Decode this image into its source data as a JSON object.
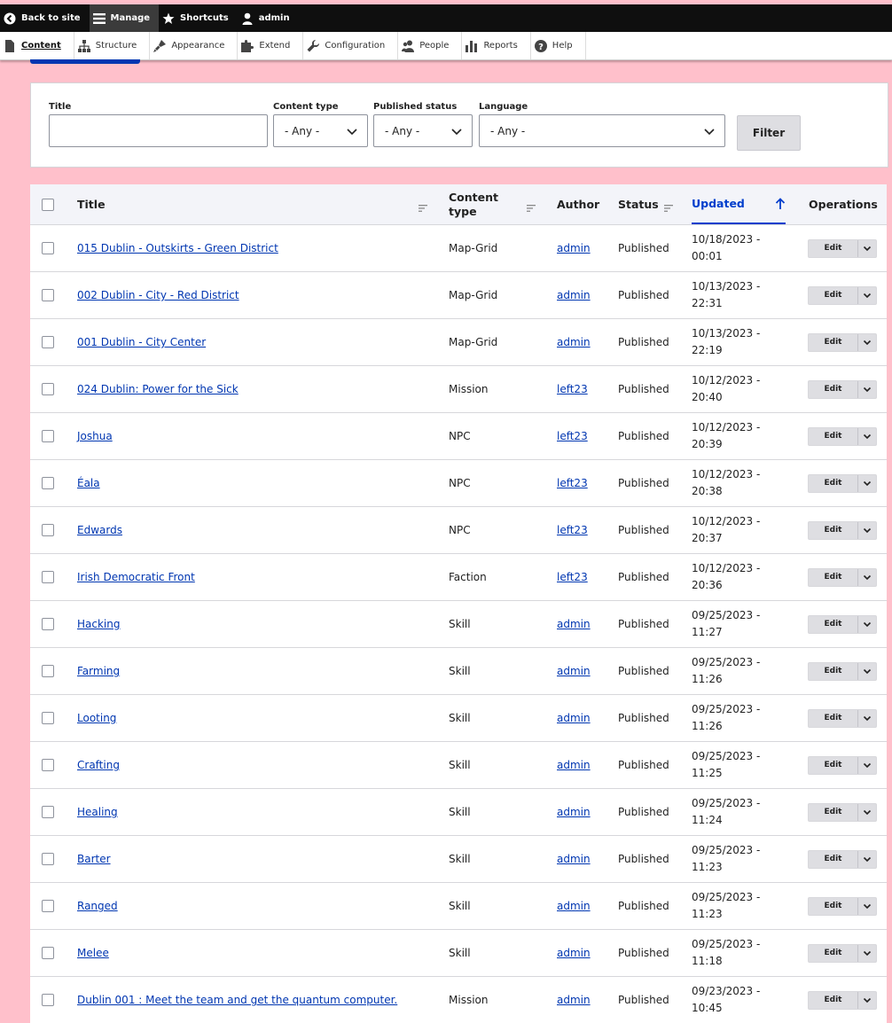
{
  "toolbar": {
    "back": "Back to site",
    "manage": "Manage",
    "shortcuts": "Shortcuts",
    "user": "admin"
  },
  "tray": {
    "items": [
      "Content",
      "Structure",
      "Appearance",
      "Extend",
      "Configuration",
      "People",
      "Reports",
      "Help"
    ]
  },
  "filters": {
    "title_label": "Title",
    "title_value": "",
    "type_label": "Content type",
    "type_value": "- Any -",
    "status_label": "Published status",
    "status_value": "- Any -",
    "lang_label": "Language",
    "lang_value": "- Any -",
    "button": "Filter"
  },
  "table": {
    "headers": {
      "title": "Title",
      "type": "Content type",
      "author": "Author",
      "status": "Status",
      "updated": "Updated",
      "operations": "Operations"
    },
    "edit_label": "Edit",
    "rows": [
      {
        "title": "015 Dublin - Outskirts - Green District",
        "type": "Map-Grid",
        "author": "admin",
        "status": "Published",
        "date": "10/18/2023 -",
        "time": "00:01"
      },
      {
        "title": "002 Dublin - City - Red District",
        "type": "Map-Grid",
        "author": "admin",
        "status": "Published",
        "date": "10/13/2023 -",
        "time": "22:31"
      },
      {
        "title": "001 Dublin - City Center",
        "type": "Map-Grid",
        "author": "admin",
        "status": "Published",
        "date": "10/13/2023 -",
        "time": "22:19"
      },
      {
        "title": "024 Dublin: Power for the Sick",
        "type": "Mission",
        "author": "left23",
        "status": "Published",
        "date": "10/12/2023 -",
        "time": "20:40"
      },
      {
        "title": "Joshua",
        "type": "NPC",
        "author": "left23",
        "status": "Published",
        "date": "10/12/2023 -",
        "time": "20:39"
      },
      {
        "title": "Éala",
        "type": "NPC",
        "author": "left23",
        "status": "Published",
        "date": "10/12/2023 -",
        "time": "20:38"
      },
      {
        "title": "Edwards",
        "type": "NPC",
        "author": "left23",
        "status": "Published",
        "date": "10/12/2023 -",
        "time": "20:37"
      },
      {
        "title": "Irish Democratic Front",
        "type": "Faction",
        "author": "left23",
        "status": "Published",
        "date": "10/12/2023 -",
        "time": "20:36"
      },
      {
        "title": "Hacking",
        "type": "Skill",
        "author": "admin",
        "status": "Published",
        "date": "09/25/2023 -",
        "time": "11:27"
      },
      {
        "title": "Farming",
        "type": "Skill",
        "author": "admin",
        "status": "Published",
        "date": "09/25/2023 -",
        "time": "11:26"
      },
      {
        "title": "Looting",
        "type": "Skill",
        "author": "admin",
        "status": "Published",
        "date": "09/25/2023 -",
        "time": "11:26"
      },
      {
        "title": "Crafting",
        "type": "Skill",
        "author": "admin",
        "status": "Published",
        "date": "09/25/2023 -",
        "time": "11:25"
      },
      {
        "title": "Healing",
        "type": "Skill",
        "author": "admin",
        "status": "Published",
        "date": "09/25/2023 -",
        "time": "11:24"
      },
      {
        "title": "Barter",
        "type": "Skill",
        "author": "admin",
        "status": "Published",
        "date": "09/25/2023 -",
        "time": "11:23"
      },
      {
        "title": "Ranged",
        "type": "Skill",
        "author": "admin",
        "status": "Published",
        "date": "09/25/2023 -",
        "time": "11:23"
      },
      {
        "title": "Melee",
        "type": "Skill",
        "author": "admin",
        "status": "Published",
        "date": "09/25/2023 -",
        "time": "11:18"
      },
      {
        "title": "Dublin 001 : Meet the team and get the quantum computer.",
        "type": "Mission",
        "author": "admin",
        "status": "Published",
        "date": "09/23/2023 -",
        "time": "10:45"
      }
    ]
  }
}
